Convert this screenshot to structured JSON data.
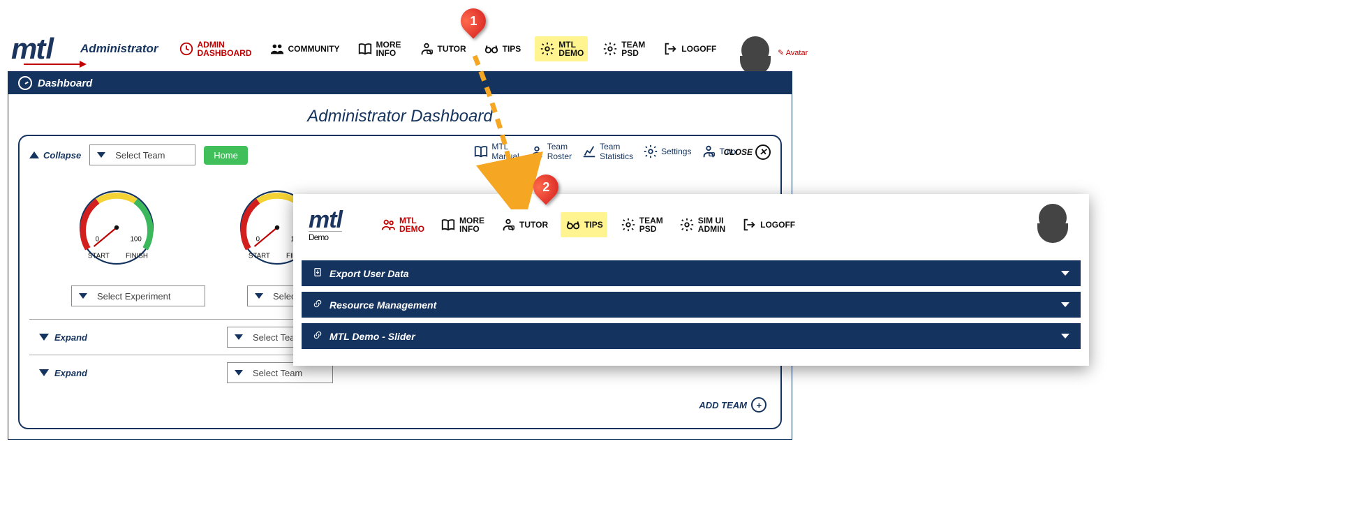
{
  "logo": {
    "brand": "mtl"
  },
  "role_label": "Administrator",
  "main_nav": {
    "admin_dashboard": "ADMIN\nDASHBOARD",
    "community": "COMMUNITY",
    "more_info": "MORE\nINFO",
    "tutor": "TUTOR",
    "tips": "TIPS",
    "mtl_demo": "MTL\nDEMO",
    "team_psd": "TEAM\nPSD",
    "logoff": "LOGOFF"
  },
  "avatar_link": "Avatar",
  "dashboard": {
    "title_tab": "Dashboard",
    "heading": "Administrator Dashboard",
    "panel": {
      "collapse": "Collapse",
      "select_team": "Select Team",
      "home": "Home",
      "right": {
        "mtl_manual": "MTL\nManual",
        "team_roster": "Team\nRoster",
        "team_stats": "Team\nStatistics",
        "settings": "Settings",
        "tutor": "Tutor"
      },
      "close": "CLOSE",
      "gauge_labels": {
        "start": "START",
        "finish": "FINISH",
        "scale_0": "0",
        "scale_100": "100"
      },
      "select_experiment": "Select Experiment",
      "expand": "Expand",
      "add_team": "ADD TEAM"
    }
  },
  "demo": {
    "logo_sub": "Demo",
    "nav": {
      "mtl_demo": "MTL\nDEMO",
      "more_info": "MORE\nINFO",
      "tutor": "TUTOR",
      "tips": "TIPS",
      "team_psd": "TEAM\nPSD",
      "sim_ui_admin": "SIM UI\nADMIN",
      "logoff": "LOGOFF"
    },
    "accordion": {
      "export": "Export User Data",
      "resource": "Resource Management",
      "slider": "MTL Demo - Slider"
    }
  },
  "pins": {
    "one": "1",
    "two": "2"
  }
}
